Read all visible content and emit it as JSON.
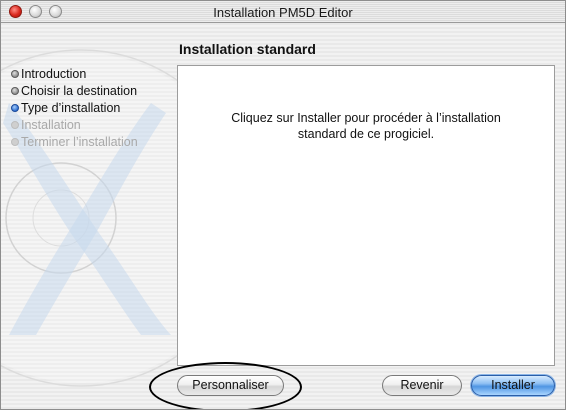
{
  "window": {
    "title": "Installation PM5D Editor"
  },
  "section_title": "Installation standard",
  "steps": [
    {
      "label": "Introduction",
      "state": "done"
    },
    {
      "label": "Choisir la destination",
      "state": "done"
    },
    {
      "label": "Type d’installation",
      "state": "current"
    },
    {
      "label": "Installation",
      "state": "future"
    },
    {
      "label": "Terminer l’installation",
      "state": "future"
    }
  ],
  "content": {
    "line1": "Cliquez sur Installer pour procéder à l’installation",
    "line2": "standard de ce progiciel."
  },
  "buttons": {
    "customize": "Personnaliser",
    "back": "Revenir",
    "install": "Installer"
  },
  "colors": {
    "current_step": "#2f6fd1",
    "default_button": "#4f95e3",
    "close_button": "#d9281e"
  }
}
